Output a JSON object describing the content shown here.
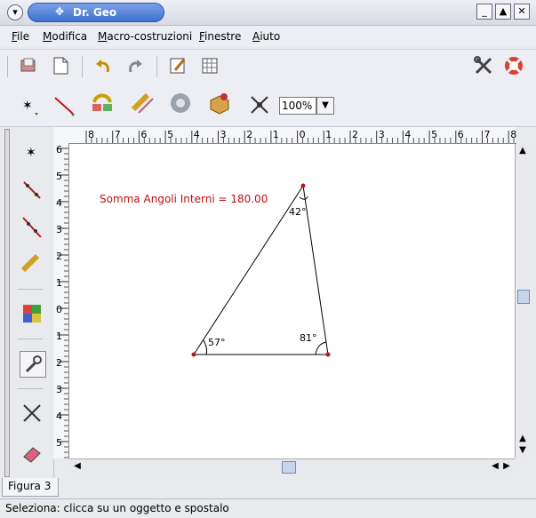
{
  "window": {
    "title": "Dr. Geo"
  },
  "menu": [
    {
      "label": "File",
      "u": "F",
      "rest": "ile"
    },
    {
      "label": "Modifica",
      "u": "M",
      "rest": "odifica"
    },
    {
      "label": "Macro-costruzioni",
      "u": "M",
      "rest": "acro-costruzioni"
    },
    {
      "label": "Finestre",
      "u": "F",
      "rest": "inestre"
    },
    {
      "label": "Aiuto",
      "u": "A",
      "rest": "iuto"
    }
  ],
  "toolbar": {
    "zoom": "100%"
  },
  "rulers": {
    "top": [
      "8",
      "7",
      "6",
      "5",
      "4",
      "3",
      "2",
      "1",
      "0",
      "1",
      "2",
      "3",
      "4",
      "5",
      "6",
      "7",
      "8"
    ],
    "left": [
      "6",
      "5",
      "4",
      "3",
      "2",
      "1",
      "0",
      "1",
      "2",
      "3",
      "4",
      "5"
    ]
  },
  "canvas": {
    "annotation": "Somma Angoli Interni = 180.00",
    "angles": {
      "top": "42°",
      "left": "57°",
      "right": "81°"
    }
  },
  "tab": {
    "label": "Figura 3"
  },
  "status": {
    "text": "Seleziona: clicca su un oggetto e spostalo"
  },
  "colors": {
    "annotation": "#c01010",
    "point": "#b01818",
    "title_pill": "#4a78d6"
  }
}
